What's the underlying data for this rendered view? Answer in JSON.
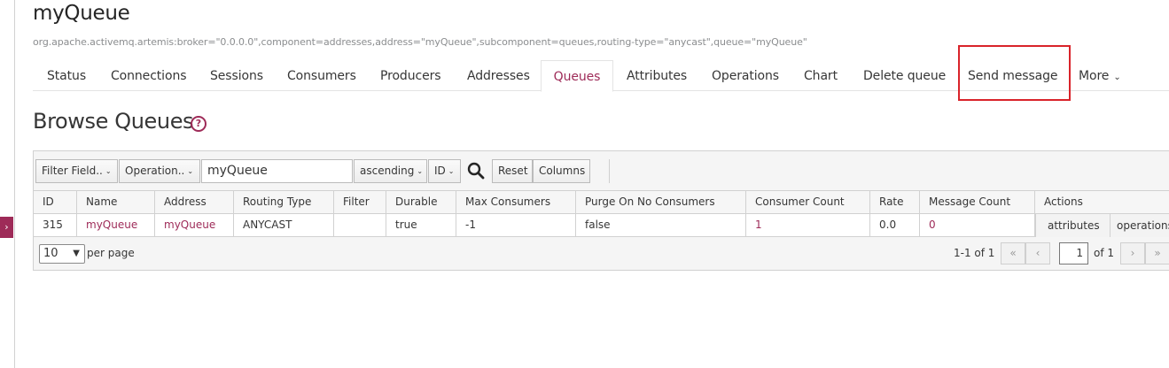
{
  "page": {
    "title": "myQueue",
    "mbean": "org.apache.activemq.artemis:broker=\"0.0.0.0\",component=addresses,address=\"myQueue\",subcomponent=queues,routing-type=\"anycast\",queue=\"myQueue\""
  },
  "tabs": [
    {
      "label": "Status"
    },
    {
      "label": "Connections"
    },
    {
      "label": "Sessions"
    },
    {
      "label": "Consumers"
    },
    {
      "label": "Producers"
    },
    {
      "label": "Addresses"
    },
    {
      "label": "Queues",
      "active": true
    },
    {
      "label": "Attributes"
    },
    {
      "label": "Operations"
    },
    {
      "label": "Chart"
    },
    {
      "label": "Delete queue"
    },
    {
      "label": "Send message"
    },
    {
      "label": "More"
    }
  ],
  "section": {
    "heading": "Browse Queues",
    "help_glyph": "?"
  },
  "toolbar": {
    "filter_field": "Filter Field..",
    "operation": "Operation..",
    "filter_value": "myQueue",
    "sort_order": "ascending",
    "sort_field": "ID",
    "reset": "Reset",
    "columns": "Columns"
  },
  "table": {
    "headers": [
      "ID",
      "Name",
      "Address",
      "Routing Type",
      "Filter",
      "Durable",
      "Max Consumers",
      "Purge On No Consumers",
      "Consumer Count",
      "Rate",
      "Message Count",
      "Actions"
    ],
    "rows": [
      {
        "id": "315",
        "name": "myQueue",
        "address": "myQueue",
        "routing_type": "ANYCAST",
        "filter": "",
        "durable": "true",
        "max_consumers": "-1",
        "purge_on_no_consumers": "false",
        "consumer_count": "1",
        "rate": "0.0",
        "message_count": "0",
        "actions": [
          "attributes",
          "operations"
        ]
      }
    ]
  },
  "pagination": {
    "per_page": "10",
    "per_page_label": "per page",
    "range": "1-1 of 1",
    "current_page": "1",
    "of_pages": "of 1"
  },
  "colors": {
    "accent": "#9e2b58",
    "highlight_box": "#d9232a"
  }
}
